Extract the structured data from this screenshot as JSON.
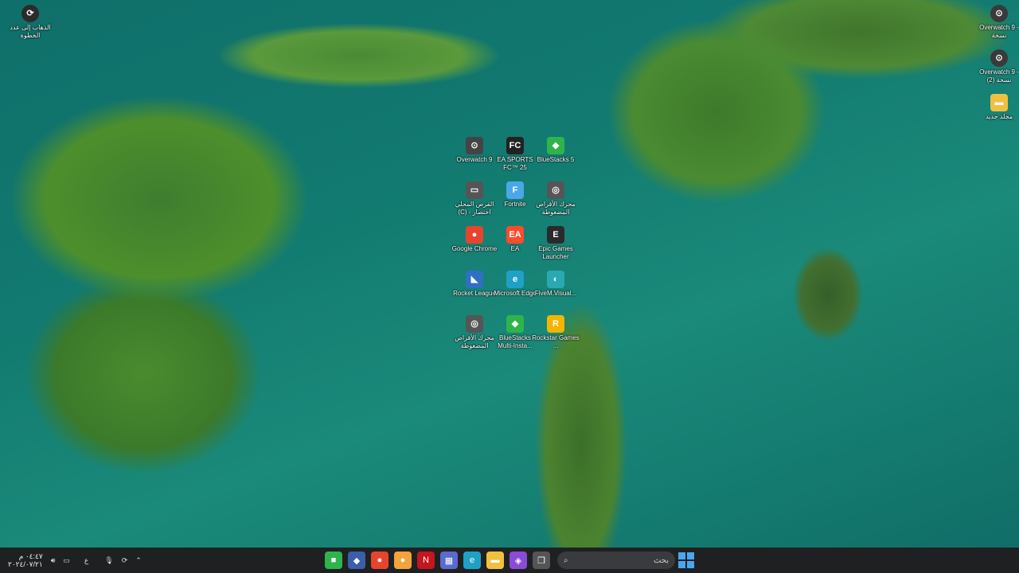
{
  "desktop_top_left": {
    "label": "الذهاب إلى عدد الخطوة"
  },
  "desktop_right": [
    {
      "label": "Overwatch 9 - نسخة",
      "icon": "overwatch-icon"
    },
    {
      "label": "Overwatch 9 - نسخة (2)",
      "icon": "overwatch-icon"
    },
    {
      "label": "مجلد جديد",
      "icon": "folder-icon"
    }
  ],
  "desktop_grid": [
    {
      "label": "Overwatch 9",
      "icon": "overwatch-icon",
      "color": "#444"
    },
    {
      "label": "EA SPORTS FC™ 25",
      "icon": "ea-sports-fc-icon",
      "color": "#222"
    },
    {
      "label": "BlueStacks 5",
      "icon": "bluestacks-icon",
      "color": "#2fb44b"
    },
    {
      "label": "القرص المحلي (C) - اختصار",
      "icon": "drive-icon",
      "color": "#555"
    },
    {
      "label": "Fortnite",
      "icon": "fortnite-icon",
      "color": "#4aa8e8"
    },
    {
      "label": "محرك الأقراص المضغوطة",
      "icon": "disc-icon",
      "color": "#555"
    },
    {
      "label": "Google Chrome",
      "icon": "chrome-icon",
      "color": "#e7442e"
    },
    {
      "label": "EA",
      "icon": "ea-icon",
      "color": "#ff4b2b"
    },
    {
      "label": "Epic Games Launcher",
      "icon": "epic-games-icon",
      "color": "#2a2a2a"
    },
    {
      "label": "Rocket League",
      "icon": "rocket-league-icon",
      "color": "#2f6fc4"
    },
    {
      "label": "Microsoft Edge",
      "icon": "edge-icon",
      "color": "#1fa1c6"
    },
    {
      "label": "FiveM.Visual...",
      "icon": "fivem-icon",
      "color": "#2aa9b5"
    },
    {
      "label": "محرك الأقراص المضغوطة",
      "icon": "disc-icon",
      "color": "#555"
    },
    {
      "label": "BlueStacks Multi-Insta...",
      "icon": "bluestacks-multi-icon",
      "color": "#2fb44b"
    },
    {
      "label": "Rockstar Games ...",
      "icon": "rockstar-icon",
      "color": "#f4b400"
    }
  ],
  "taskbar": {
    "time": "٠٤:٤٧ م",
    "date": "٢٠٢٤/٠٧/٢١",
    "language": "ع",
    "search_placeholder": "بحث",
    "center_icons": [
      {
        "name": "app-green-icon",
        "color": "#2fb44b",
        "glyph": "■"
      },
      {
        "name": "shield-app-icon",
        "color": "#3a5fa8",
        "glyph": "◆"
      },
      {
        "name": "chrome-taskbar-icon",
        "color": "#e7442e",
        "glyph": "●"
      },
      {
        "name": "notification-app-icon",
        "color": "#f2a33a",
        "glyph": "●"
      },
      {
        "name": "netflix-icon",
        "color": "#c4161c",
        "glyph": "N"
      },
      {
        "name": "store-icon",
        "color": "#5a6acf",
        "glyph": "▦"
      },
      {
        "name": "edge-taskbar-icon",
        "color": "#1fa1c6",
        "glyph": "e"
      },
      {
        "name": "file-explorer-icon",
        "color": "#f0c040",
        "glyph": "▬"
      },
      {
        "name": "multicolor-app-icon",
        "color": "#8a4bd6",
        "glyph": "◈"
      },
      {
        "name": "task-view-icon",
        "color": "#555",
        "glyph": "❐"
      }
    ]
  }
}
